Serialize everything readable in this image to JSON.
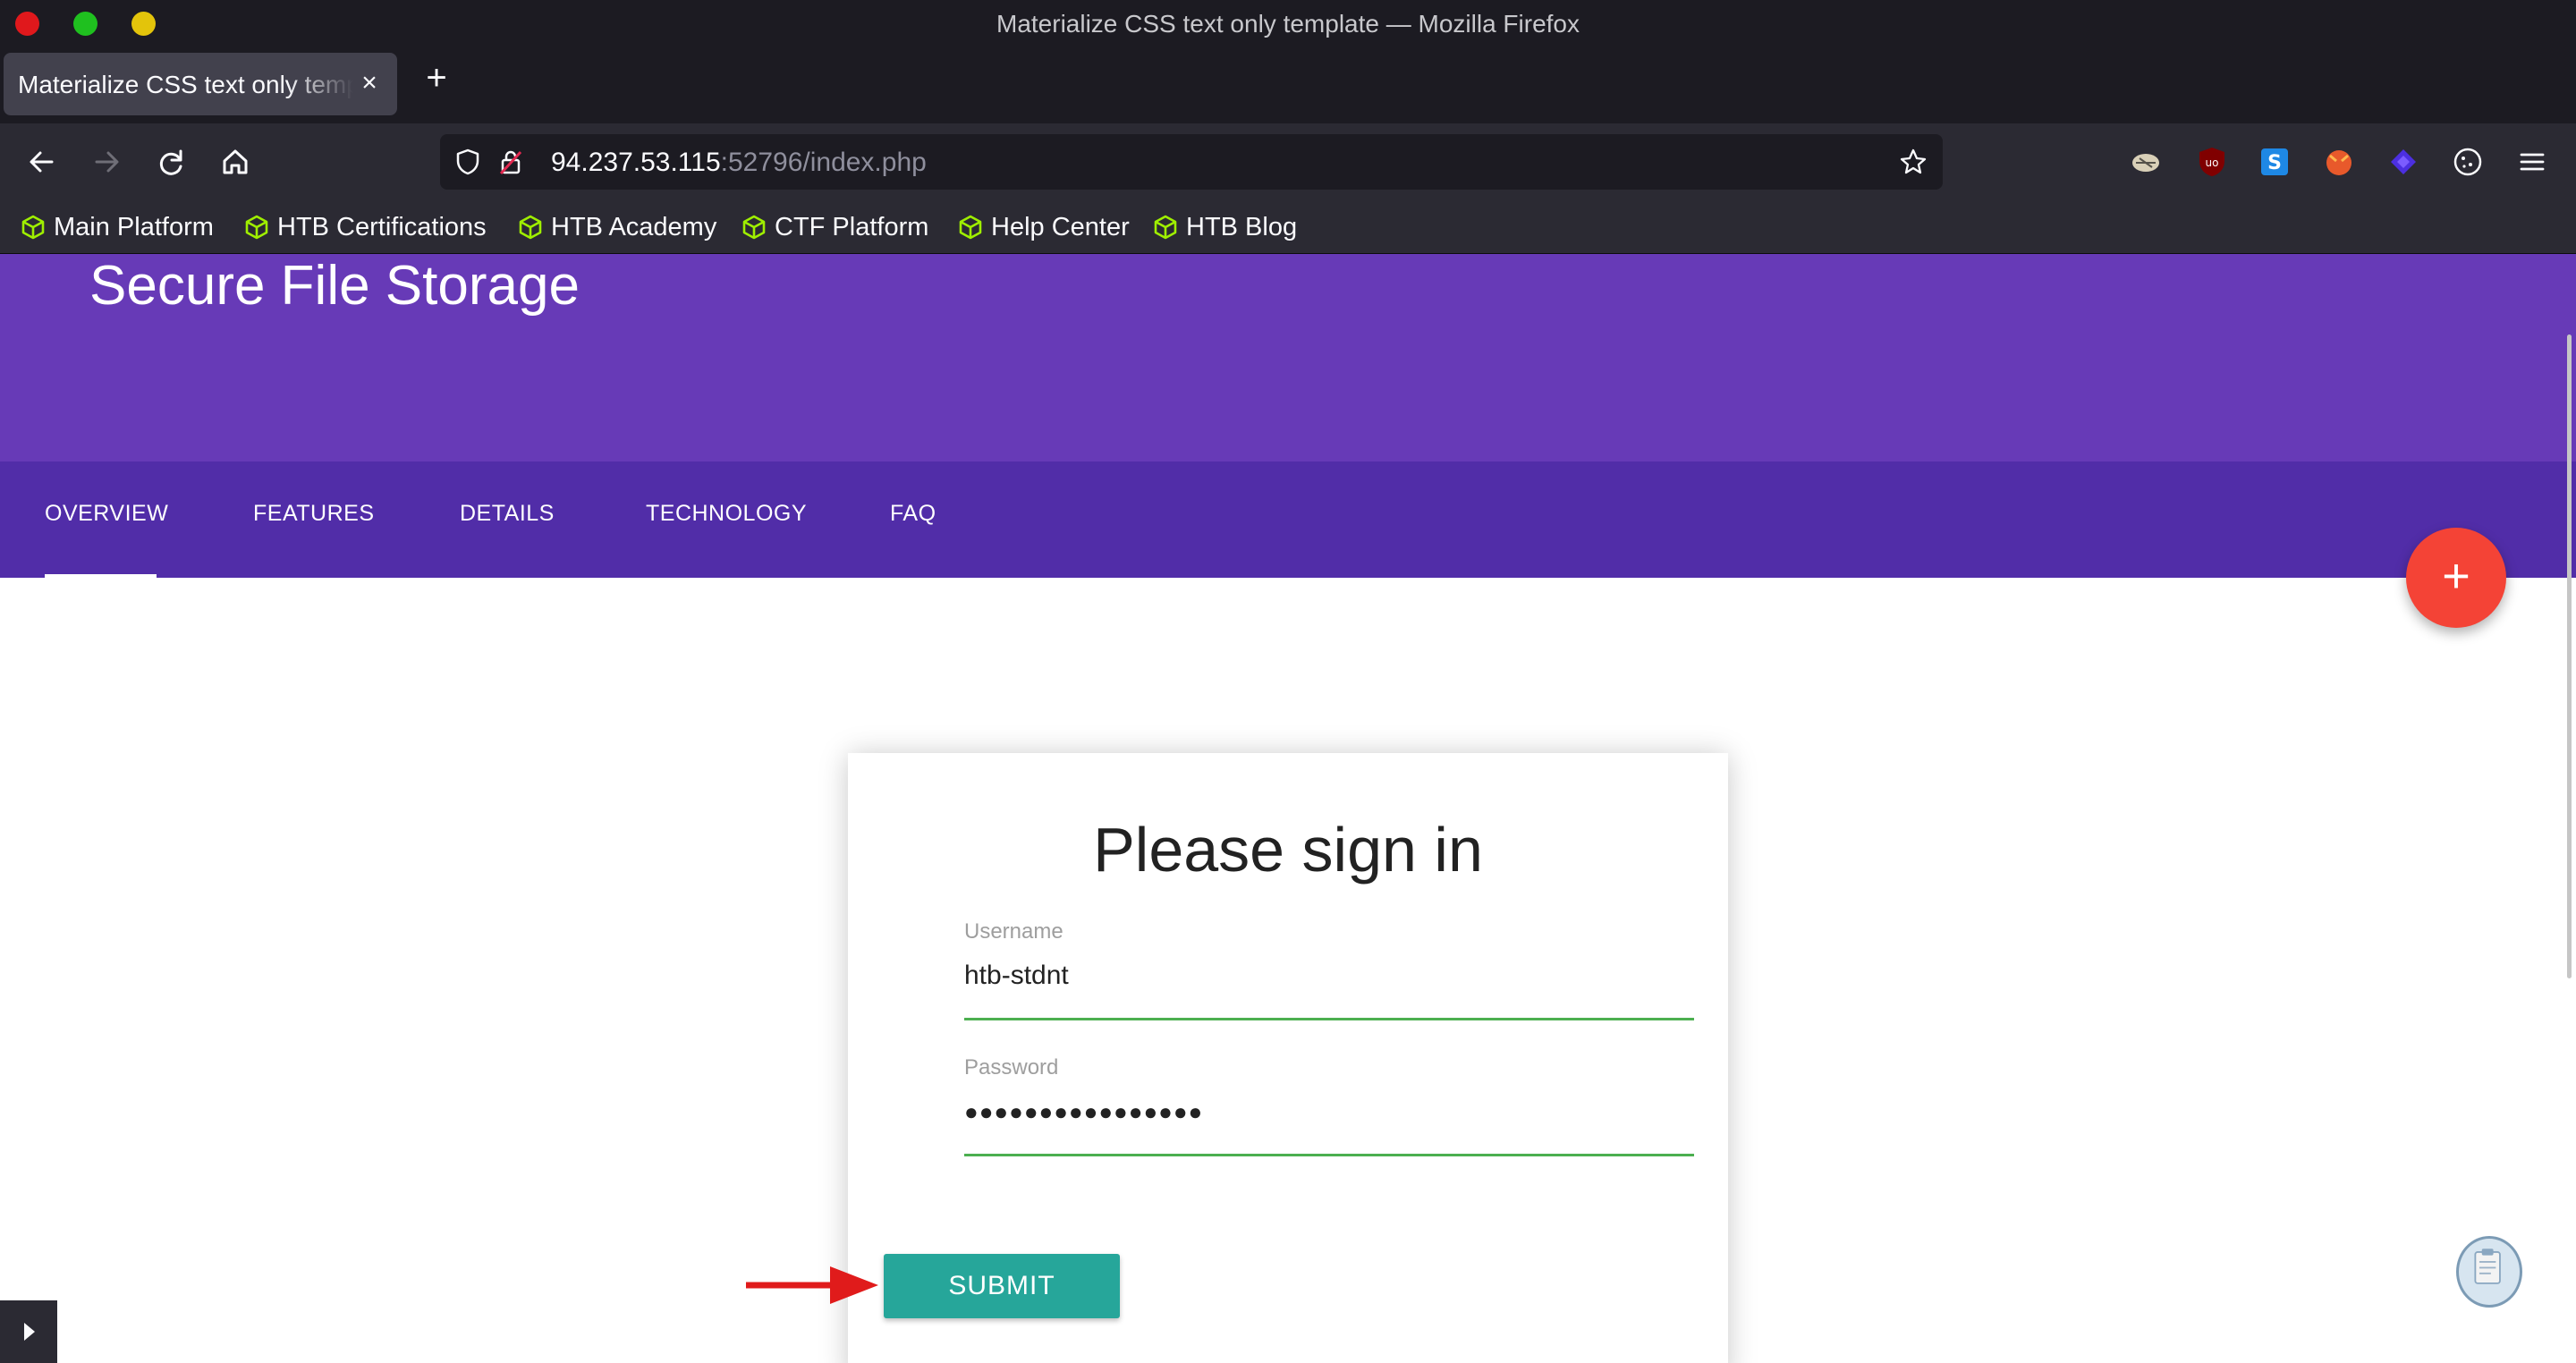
{
  "browser": {
    "window_title": "Materialize CSS text only template — Mozilla Firefox",
    "tab_title": "Materialize CSS text only template",
    "tab_close": "×",
    "new_tab": "+",
    "url_host": "94.237.53.115",
    "url_rest": ":52796/index.php",
    "bookmarks": [
      {
        "label": "Main Platform",
        "icon": "htb-cube-icon"
      },
      {
        "label": "HTB Certifications",
        "icon": "htb-cube-icon"
      },
      {
        "label": "HTB Academy",
        "icon": "htb-cube-icon"
      },
      {
        "label": "CTF Platform",
        "icon": "htb-cube-icon"
      },
      {
        "label": "Help Center",
        "icon": "htb-cube-icon"
      },
      {
        "label": "HTB Blog",
        "icon": "htb-cube-icon"
      }
    ]
  },
  "page": {
    "hero_title": "Secure File Storage",
    "tabs": [
      "OVERVIEW",
      "FEATURES",
      "DETAILS",
      "TECHNOLOGY",
      "FAQ"
    ],
    "active_tab": "OVERVIEW",
    "fab_label": "+",
    "login": {
      "title": "Please sign in",
      "username_label": "Username",
      "username_value": "htb-stdnt",
      "password_label": "Password",
      "password_value": "●●●●●●●●●●●●●●●●",
      "submit_label": "SUBMIT"
    }
  },
  "colors": {
    "hero": "#673ab7",
    "tabs_bar": "#512da8",
    "fab": "#f44336",
    "submit": "#26a69a",
    "field_underline": "#4caf50",
    "annotation_arrow": "#e01b1b"
  }
}
